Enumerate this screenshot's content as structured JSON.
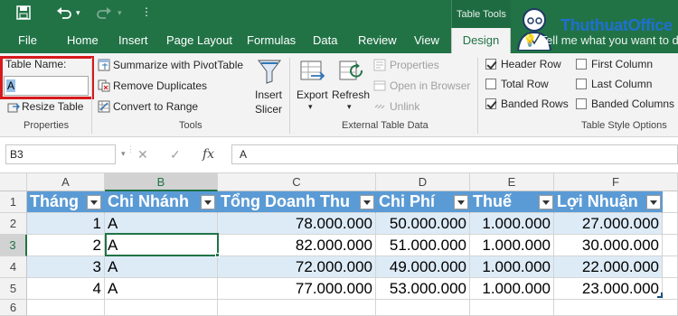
{
  "titlebar": {
    "context_tab_group": "Table Tools",
    "watermark_text": "ThuthuatOffice"
  },
  "tabs": [
    {
      "label": "File"
    },
    {
      "label": "Home"
    },
    {
      "label": "Insert"
    },
    {
      "label": "Page Layout"
    },
    {
      "label": "Formulas"
    },
    {
      "label": "Data"
    },
    {
      "label": "Review"
    },
    {
      "label": "View"
    },
    {
      "label": "Design",
      "active": true
    }
  ],
  "tell_me": "Tell me what you want to do",
  "ribbon": {
    "properties": {
      "group_label": "Properties",
      "table_name_label": "Table Name:",
      "table_name_value": "A",
      "resize_table": "Resize Table"
    },
    "tools": {
      "group_label": "Tools",
      "summarize": "Summarize with PivotTable",
      "remove_duplicates": "Remove Duplicates",
      "convert_to_range": "Convert to Range",
      "insert_slicer_line1": "Insert",
      "insert_slicer_line2": "Slicer"
    },
    "external": {
      "group_label": "External Table Data",
      "export": "Export",
      "refresh": "Refresh",
      "properties": "Properties",
      "open_in_browser": "Open in Browser",
      "unlink": "Unlink"
    },
    "style_options": {
      "group_label": "Table Style Options",
      "header_row": {
        "label": "Header Row",
        "checked": true
      },
      "total_row": {
        "label": "Total Row",
        "checked": false
      },
      "banded_rows": {
        "label": "Banded Rows",
        "checked": true
      },
      "first_column": {
        "label": "First Column",
        "checked": false
      },
      "last_column": {
        "label": "Last Column",
        "checked": false
      },
      "banded_columns": {
        "label": "Banded Columns",
        "checked": false
      }
    }
  },
  "formula_bar": {
    "name_box": "B3",
    "fx": "fx",
    "cancel": "✕",
    "enter": "✓",
    "content": "A"
  },
  "sheet": {
    "columns": [
      "A",
      "B",
      "C",
      "D",
      "E",
      "F"
    ],
    "rows": [
      "1",
      "2",
      "3",
      "4",
      "5",
      "6"
    ],
    "header": [
      "Tháng",
      "Chi Nhánh",
      "Tổng Doanh Thu",
      "Chi Phí",
      "Thuế",
      "Lợi Nhuận"
    ],
    "data": [
      [
        "1",
        "A",
        "78.000.000",
        "50.000.000",
        "1.000.000",
        "27.000.000"
      ],
      [
        "2",
        "A",
        "82.000.000",
        "51.000.000",
        "1.000.000",
        "30.000.000"
      ],
      [
        "3",
        "A",
        "72.000.000",
        "49.000.000",
        "1.000.000",
        "22.000.000"
      ],
      [
        "4",
        "A",
        "77.000.000",
        "53.000.000",
        "1.000.000",
        "23.000.000"
      ]
    ],
    "active_cell": "B3"
  },
  "colors": {
    "excel_green": "#217346",
    "table_header": "#5b9bd5",
    "band": "#ddebf7",
    "highlight_box": "#d7191c"
  }
}
